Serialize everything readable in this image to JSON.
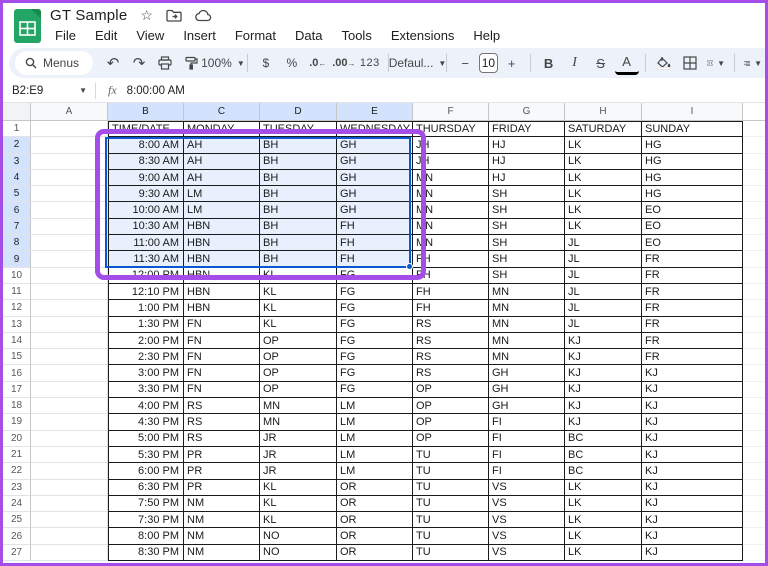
{
  "titlebar": {
    "title": "GT Sample",
    "menus": [
      "File",
      "Edit",
      "View",
      "Insert",
      "Format",
      "Data",
      "Tools",
      "Extensions",
      "Help"
    ]
  },
  "toolbar": {
    "menus_label": "Menus",
    "zoom_level": "100%",
    "currency": "$",
    "percent": "%",
    "decrease_decimal": ".0",
    "increase_decimal": ".00",
    "number_format": "123",
    "font_name": "Defaul...",
    "font_size": "10",
    "decrease_font_size": "−",
    "increase_font_size": "+",
    "bold": "B",
    "italic": "I",
    "strikethrough": "S",
    "text_color": "A"
  },
  "formula_bar": {
    "name_box": "B2:E9",
    "fx_label": "fx",
    "value": "8:00:00 AM"
  },
  "grid": {
    "column_headers": [
      "A",
      "B",
      "C",
      "D",
      "E",
      "F",
      "G",
      "H",
      "I"
    ],
    "selected_column_headers": [
      "B",
      "C",
      "D",
      "E"
    ],
    "selected_row_numbers": [
      2,
      3,
      4,
      5,
      6,
      7,
      8,
      9
    ],
    "selected_range": "B2:E9",
    "rows": [
      {
        "n": 1,
        "cells": [
          "TIME/DATE",
          "MONDAY",
          "TUESDAY",
          "WEDNESDAY",
          "THURSDAY",
          "FRIDAY",
          "SATURDAY",
          "SUNDAY"
        ]
      },
      {
        "n": 2,
        "cells": [
          "8:00 AM",
          "AH",
          "BH",
          "GH",
          "JH",
          "HJ",
          "LK",
          "HG"
        ]
      },
      {
        "n": 3,
        "cells": [
          "8:30 AM",
          "AH",
          "BH",
          "GH",
          "JH",
          "HJ",
          "LK",
          "HG"
        ]
      },
      {
        "n": 4,
        "cells": [
          "9:00 AM",
          "AH",
          "BH",
          "GH",
          "MN",
          "HJ",
          "LK",
          "HG"
        ]
      },
      {
        "n": 5,
        "cells": [
          "9:30 AM",
          "LM",
          "BH",
          "GH",
          "MN",
          "SH",
          "LK",
          "HG"
        ]
      },
      {
        "n": 6,
        "cells": [
          "10:00 AM",
          "LM",
          "BH",
          "GH",
          "MN",
          "SH",
          "LK",
          "EO"
        ]
      },
      {
        "n": 7,
        "cells": [
          "10:30 AM",
          "HBN",
          "BH",
          "FH",
          "MN",
          "SH",
          "LK",
          "EO"
        ]
      },
      {
        "n": 8,
        "cells": [
          "11:00 AM",
          "HBN",
          "BH",
          "FH",
          "MN",
          "SH",
          "JL",
          "EO"
        ]
      },
      {
        "n": 9,
        "cells": [
          "11:30 AM",
          "HBN",
          "BH",
          "FH",
          "FH",
          "SH",
          "JL",
          "FR"
        ]
      },
      {
        "n": 10,
        "cells": [
          "12:00 PM",
          "HBN",
          "KL",
          "FG",
          "FH",
          "SH",
          "JL",
          "FR"
        ]
      },
      {
        "n": 11,
        "cells": [
          "12:10 PM",
          "HBN",
          "KL",
          "FG",
          "FH",
          "MN",
          "JL",
          "FR"
        ]
      },
      {
        "n": 12,
        "cells": [
          "1:00 PM",
          "HBN",
          "KL",
          "FG",
          "FH",
          "MN",
          "JL",
          "FR"
        ]
      },
      {
        "n": 13,
        "cells": [
          "1:30 PM",
          "FN",
          "KL",
          "FG",
          "RS",
          "MN",
          "JL",
          "FR"
        ]
      },
      {
        "n": 14,
        "cells": [
          "2:00 PM",
          "FN",
          "OP",
          "FG",
          "RS",
          "MN",
          "KJ",
          "FR"
        ]
      },
      {
        "n": 15,
        "cells": [
          "2:30 PM",
          "FN",
          "OP",
          "FG",
          "RS",
          "MN",
          "KJ",
          "FR"
        ]
      },
      {
        "n": 16,
        "cells": [
          "3:00 PM",
          "FN",
          "OP",
          "FG",
          "RS",
          "GH",
          "KJ",
          "KJ"
        ]
      },
      {
        "n": 17,
        "cells": [
          "3:30 PM",
          "FN",
          "OP",
          "FG",
          "OP",
          "GH",
          "KJ",
          "KJ"
        ]
      },
      {
        "n": 18,
        "cells": [
          "4:00 PM",
          "RS",
          "MN",
          "LM",
          "OP",
          "GH",
          "KJ",
          "KJ"
        ]
      },
      {
        "n": 19,
        "cells": [
          "4:30 PM",
          "RS",
          "MN",
          "LM",
          "OP",
          "FI",
          "KJ",
          "KJ"
        ]
      },
      {
        "n": 20,
        "cells": [
          "5:00 PM",
          "RS",
          "JR",
          "LM",
          "OP",
          "FI",
          "BC",
          "KJ"
        ]
      },
      {
        "n": 21,
        "cells": [
          "5:30 PM",
          "PR",
          "JR",
          "LM",
          "TU",
          "FI",
          "BC",
          "KJ"
        ]
      },
      {
        "n": 22,
        "cells": [
          "6:00 PM",
          "PR",
          "JR",
          "LM",
          "TU",
          "FI",
          "BC",
          "KJ"
        ]
      },
      {
        "n": 23,
        "cells": [
          "6:30 PM",
          "PR",
          "KL",
          "OR",
          "TU",
          "VS",
          "LK",
          "KJ"
        ]
      },
      {
        "n": 24,
        "cells": [
          "7:50 PM",
          "NM",
          "KL",
          "OR",
          "TU",
          "VS",
          "LK",
          "KJ"
        ]
      },
      {
        "n": 25,
        "cells": [
          "7:30 PM",
          "NM",
          "KL",
          "OR",
          "TU",
          "VS",
          "LK",
          "KJ"
        ]
      },
      {
        "n": 26,
        "cells": [
          "8:00 PM",
          "NM",
          "NO",
          "OR",
          "TU",
          "VS",
          "LK",
          "KJ"
        ]
      },
      {
        "n": 27,
        "cells": [
          "8:30 PM",
          "NM",
          "NO",
          "OR",
          "TU",
          "VS",
          "LK",
          "KJ"
        ]
      }
    ]
  },
  "colors": {
    "annotation_purple": "#a44de8",
    "selection_blue": "#0b57d0",
    "selection_fill": "#e8f0fd",
    "selected_header_fill": "#d3e3fd",
    "toolbar_bg": "#edf2fa",
    "logo_green": "#23a566"
  }
}
